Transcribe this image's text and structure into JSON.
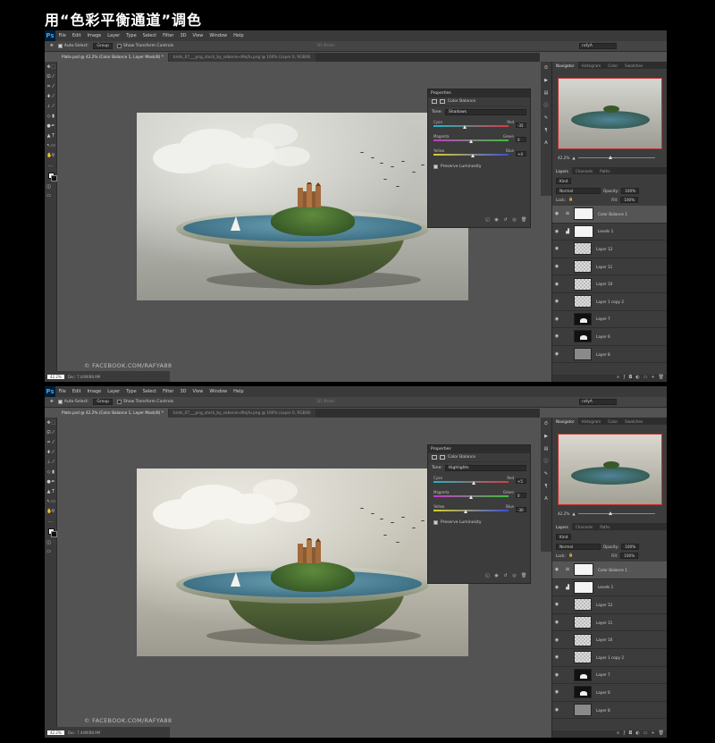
{
  "heading": "用“色彩平衡通道”调色",
  "app": {
    "logo": "Ps",
    "menus": [
      "File",
      "Edit",
      "Image",
      "Layer",
      "Type",
      "Select",
      "Filter",
      "3D",
      "View",
      "Window",
      "Help"
    ]
  },
  "options": {
    "auto_select": "Auto-Select:",
    "group": "Group",
    "transform": "Show Transform Controls",
    "mode_3d": "3D Mode:",
    "workspace": "rafyA"
  },
  "tabs": [
    "Plate.psd @ 42.2% (Color Balance 1, Layer Mask/8) *",
    "birds_07___png_stock_by_sebonie-d9ojfu.png @ 100% (Layer 0, RGB/8)"
  ],
  "copyright": "© FACEBOOK.COM/RAFYA88",
  "status": {
    "zoom": "42.2%",
    "doc": "Doc: 7.44M/88.9M"
  },
  "properties": {
    "header": "Properties",
    "title": "Color Balance",
    "tone_label": "Tone:",
    "preserve": "Preserve Luminosity"
  },
  "panel_tabs": [
    "Navigator",
    "Histogram",
    "Color",
    "Swatches"
  ],
  "nav_zoom": "42.2%",
  "layers_tabs": [
    "Layers",
    "Channels",
    "Paths"
  ],
  "layers_controls": {
    "kind": "Kind",
    "blend": "Normal",
    "opacity_label": "Opacity:",
    "opacity": "100%",
    "lock_label": "Lock:",
    "fill_label": "Fill:",
    "fill": "100%"
  },
  "layers": [
    {
      "name": "Color Balance 1",
      "type": "adjust",
      "icon": "balance-icon",
      "sel": true
    },
    {
      "name": "Levels 1",
      "type": "adjust",
      "icon": "levels-icon",
      "sel": false
    },
    {
      "name": "Layer 12",
      "type": "checker",
      "sel": false
    },
    {
      "name": "Layer 11",
      "type": "checker",
      "sel": false
    },
    {
      "name": "Layer 10",
      "type": "checker",
      "sel": false
    },
    {
      "name": "Layer 1 copy 2",
      "type": "checker",
      "sel": false
    },
    {
      "name": "Layer 7",
      "type": "mask",
      "sel": false
    },
    {
      "name": "Layer 6",
      "type": "mask",
      "sel": false
    },
    {
      "name": "Layer 8",
      "type": "group",
      "sel": false
    }
  ],
  "shots": [
    {
      "tone": "Shadows",
      "sliders": [
        {
          "left": "Cyan",
          "right": "Red",
          "value": "-35",
          "pos": 0.42,
          "colors": [
            "#1fb6c7",
            "#d83b3b"
          ]
        },
        {
          "left": "Magenta",
          "right": "Green",
          "value": "0",
          "pos": 0.5,
          "colors": [
            "#c43ac4",
            "#3cc13c"
          ]
        },
        {
          "left": "Yellow",
          "right": "Blue",
          "value": "+4",
          "pos": 0.52,
          "colors": [
            "#d8d02d",
            "#3c4fd8"
          ]
        }
      ]
    },
    {
      "tone": "Highlights",
      "sliders": [
        {
          "left": "Cyan",
          "right": "Red",
          "value": "+5",
          "pos": 0.53,
          "colors": [
            "#1fb6c7",
            "#d83b3b"
          ]
        },
        {
          "left": "Magenta",
          "right": "Green",
          "value": "0",
          "pos": 0.5,
          "colors": [
            "#c43ac4",
            "#3cc13c"
          ]
        },
        {
          "left": "Yellow",
          "right": "Blue",
          "value": "-30",
          "pos": 0.43,
          "colors": [
            "#d8d02d",
            "#3c4fd8"
          ]
        }
      ]
    }
  ]
}
